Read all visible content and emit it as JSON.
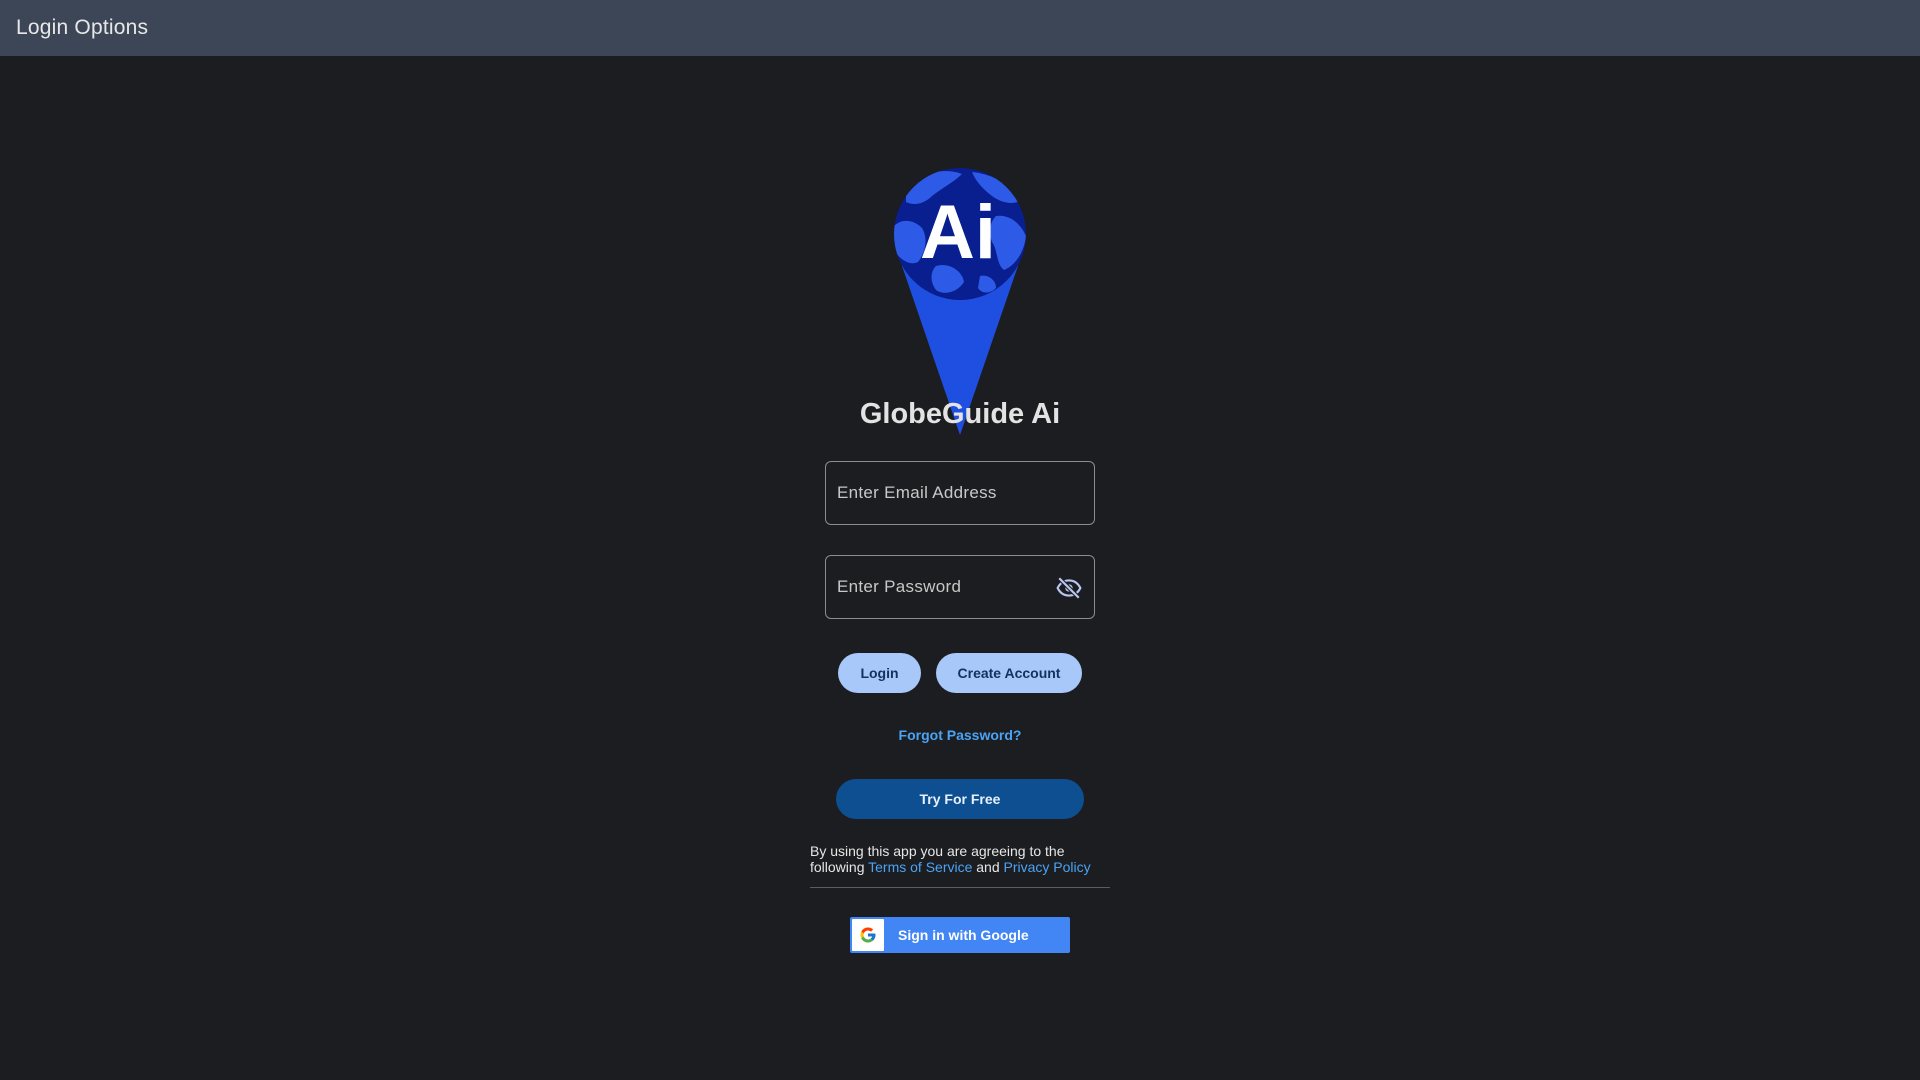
{
  "appbar": {
    "title": "Login Options"
  },
  "brand": {
    "name": "GlobeGuide Ai",
    "logo_text": "Ai",
    "logo_icon": "globe-pin-icon"
  },
  "form": {
    "email_placeholder": "Enter Email Address",
    "email_value": "",
    "password_placeholder": "Enter Password",
    "password_value": "",
    "visibility_icon": "eye-off-icon"
  },
  "actions": {
    "login_label": "Login",
    "create_account_label": "Create Account",
    "forgot_password_label": "Forgot Password?",
    "try_free_label": "Try For Free"
  },
  "terms": {
    "prefix": "By using this app you are agreeing to the following",
    "terms_link": "Terms of Service",
    "conjunction": "and",
    "privacy_link": "Privacy Policy"
  },
  "google": {
    "label": "Sign in with Google",
    "icon": "google-g-icon"
  },
  "colors": {
    "background": "#1c1d20",
    "appbar": "#3c4656",
    "pill_button": "#a8c8fa",
    "primary_button": "#0d4f91",
    "link": "#4aa3f5",
    "google_blue": "#4285f4"
  }
}
